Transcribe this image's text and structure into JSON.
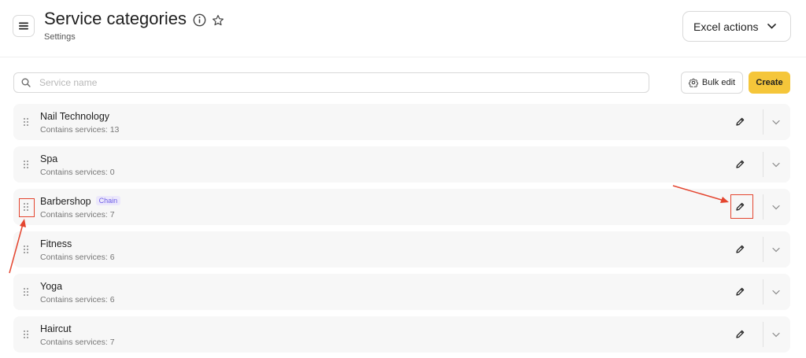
{
  "header": {
    "title": "Service categories",
    "breadcrumb": "Settings",
    "excel_actions_label": "Excel actions",
    "menu_icon": "hamburger-icon",
    "info_icon": "info-icon",
    "star_icon": "star-icon"
  },
  "toolbar": {
    "search_placeholder": "Service name",
    "search_value": "",
    "bulk_edit_label": "Bulk edit",
    "create_label": "Create"
  },
  "categories": [
    {
      "name": "Nail Technology",
      "count_text": "Contains services: 13"
    },
    {
      "name": "Spa",
      "count_text": "Contains services: 0"
    },
    {
      "name": "Barbershop",
      "badge": "Chain",
      "count_text": "Contains services: 7"
    },
    {
      "name": "Fitness",
      "count_text": "Contains services: 6"
    },
    {
      "name": "Yoga",
      "count_text": "Contains services: 6"
    },
    {
      "name": "Haircut",
      "count_text": "Contains services: 7"
    }
  ],
  "colors": {
    "accent": "#f5c63a",
    "annotation": "#e4452f",
    "badge_text": "#6c5ce7",
    "badge_bg": "#ece8fb"
  }
}
